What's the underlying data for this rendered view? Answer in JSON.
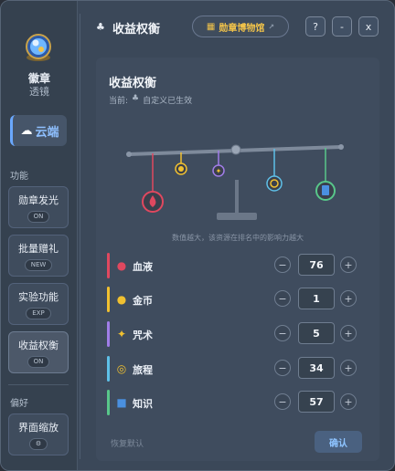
{
  "sidebar": {
    "app_name": "徽章",
    "app_sub": "透镜",
    "cloud_label": "云端",
    "section_features": "功能",
    "items": [
      {
        "title": "勋章发光",
        "badge": "ON"
      },
      {
        "title": "批量赠礼",
        "badge": "NEW"
      },
      {
        "title": "实验功能",
        "badge": "EXP"
      },
      {
        "title": "收益权衡",
        "badge": "ON"
      }
    ],
    "section_prefs": "偏好",
    "zoom_title": "界面缩放"
  },
  "header": {
    "title": "收益权衡",
    "museum_label": "勋章博物馆",
    "help": "?",
    "minimize": "-",
    "close": "x"
  },
  "panel": {
    "title": "收益权衡",
    "current_prefix": "当前:",
    "current_value": "自定义已生效",
    "hint": "数值越大，该资源在排名中的影响力越大",
    "reset_label": "恢复默认",
    "confirm_label": "确认"
  },
  "weights": [
    {
      "label": "血液",
      "value": "76",
      "color": "#e0485f",
      "icon": "blood-drop-icon"
    },
    {
      "label": "金币",
      "value": "1",
      "color": "#f0c030",
      "icon": "coin-bag-icon"
    },
    {
      "label": "咒术",
      "value": "5",
      "color": "#a07de8",
      "icon": "spell-sparkle-icon"
    },
    {
      "label": "旅程",
      "value": "34",
      "color": "#5ec0e8",
      "icon": "compass-icon"
    },
    {
      "label": "知识",
      "value": "57",
      "color": "#58c78a",
      "icon": "book-icon"
    }
  ],
  "colors": {
    "accent": "#6aa8ff",
    "gold": "#f0c24a"
  }
}
